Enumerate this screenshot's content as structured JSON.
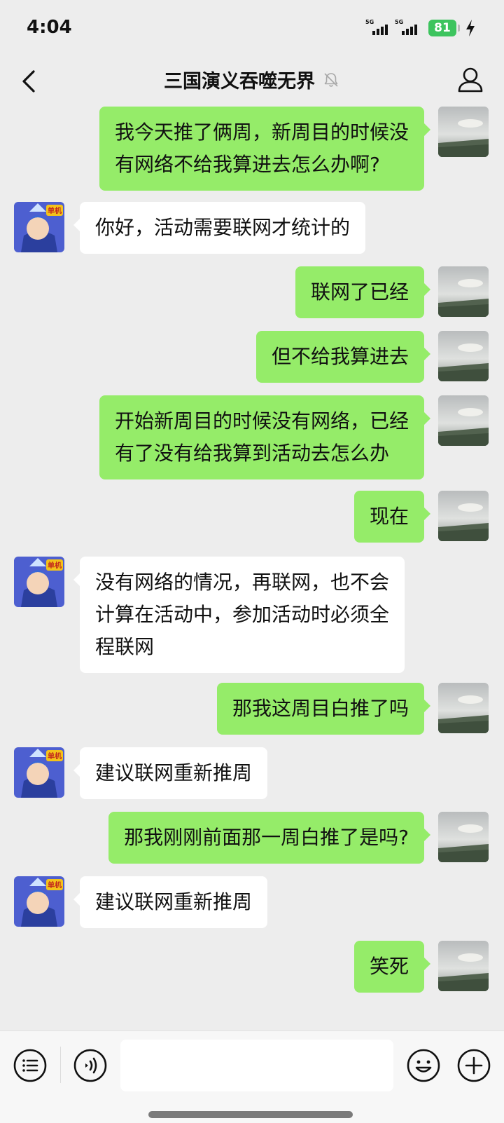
{
  "status_bar": {
    "time": "4:04",
    "signal1": "5G",
    "signal2": "5G",
    "battery": "81"
  },
  "header": {
    "title": "三国演义吞噬无界"
  },
  "avatars": {
    "self": "landscape-photo",
    "other_badge": "单机"
  },
  "messages": [
    {
      "side": "out",
      "text": "我今天推了俩周，新周目的时候没\n有网络不给我算进去怎么办啊?"
    },
    {
      "side": "in",
      "text": "你好，活动需要联网才统计的"
    },
    {
      "side": "out",
      "text": "联网了已经"
    },
    {
      "side": "out",
      "text": "但不给我算进去"
    },
    {
      "side": "out",
      "text": "开始新周目的时候没有网络，已经\n有了没有给我算到活动去怎么办"
    },
    {
      "side": "out",
      "text": "现在"
    },
    {
      "side": "in",
      "text": "没有网络的情况，再联网，也不会\n计算在活动中，参加活动时必须全\n程联网"
    },
    {
      "side": "out",
      "text": "那我这周目白推了吗"
    },
    {
      "side": "in",
      "text": "建议联网重新推周"
    },
    {
      "side": "out",
      "text": "那我刚刚前面那一周白推了是吗?"
    },
    {
      "side": "in",
      "text": "建议联网重新推周"
    },
    {
      "side": "out",
      "text": "笑死"
    }
  ],
  "input_bar": {
    "value": "",
    "placeholder": ""
  },
  "colors": {
    "outgoing_bubble": "#95ec69",
    "incoming_bubble": "#ffffff",
    "background": "#ededed",
    "battery": "#3dc45e"
  }
}
